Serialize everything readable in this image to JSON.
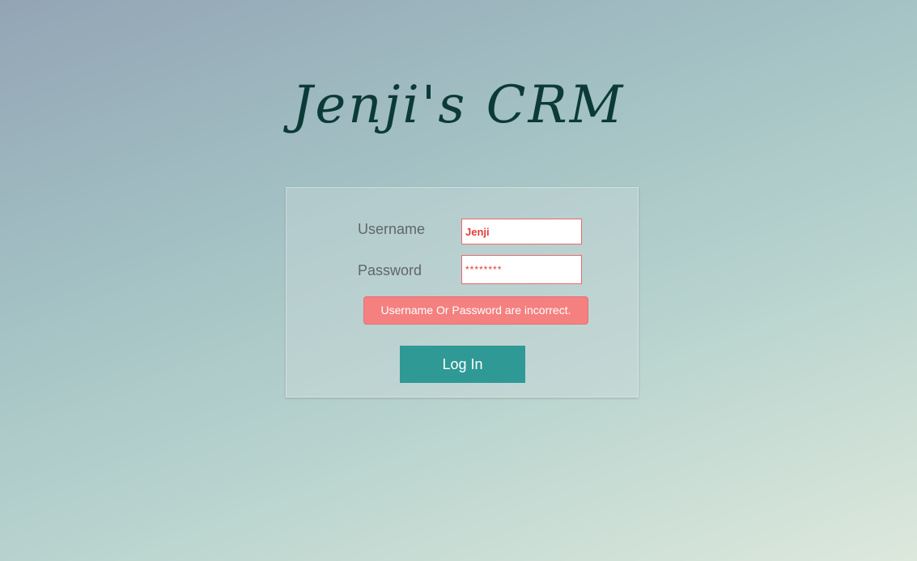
{
  "app": {
    "title": "Jenji's CRM"
  },
  "login_form": {
    "username_label": "Username",
    "username_value": "Jenji",
    "password_label": "Password",
    "password_value": "********",
    "error_message": "Username Or Password are incorrect.",
    "login_button_label": "Log In"
  },
  "colors": {
    "accent": "#2f9996",
    "error": "#f48080",
    "title": "#0b3a37"
  }
}
